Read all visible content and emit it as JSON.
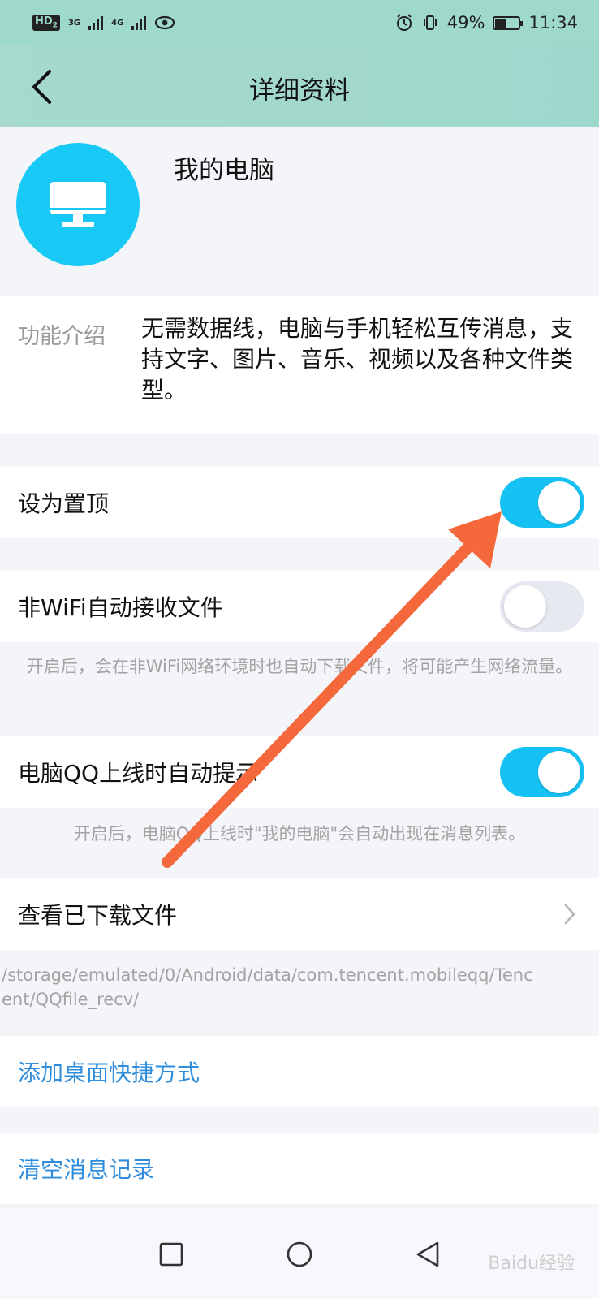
{
  "status_bar": {
    "hd": "HD",
    "hd_sub": "2",
    "net1": "3G",
    "net2": "4G",
    "battery": "49%",
    "time": "11:34"
  },
  "header": {
    "title": "详细资料"
  },
  "profile": {
    "name": "我的电脑"
  },
  "intro": {
    "label": "功能介绍",
    "text": "无需数据线，电脑与手机轻松互传消息，支持文字、图片、音乐、视频以及各种文件类型。"
  },
  "settings": {
    "pin": {
      "label": "设为置顶",
      "on": true
    },
    "nonwifi": {
      "label": "非WiFi自动接收文件",
      "on": false,
      "note": "开启后，会在非WiFi网络环境时也自动下载文件，将可能产生网络流量。"
    },
    "online_prompt": {
      "label": "电脑QQ上线时自动提示",
      "on": true,
      "note": "开启后，电脑QQ上线时\"我的电脑\"会自动出现在消息列表。"
    },
    "downloads": {
      "label": "查看已下载文件",
      "path": "/storage/emulated/0/Android/data/com.tencent.mobileqq/Tencent/QQfile_recv/"
    },
    "shortcut": {
      "label": "添加桌面快捷方式"
    },
    "clear": {
      "label": "清空消息记录"
    }
  },
  "watermark": "Baidu经验",
  "colors": {
    "accent": "#16c1f4",
    "header_bg": "#9fd9cc",
    "link": "#2f8ddb",
    "arrow": "#f4683c"
  }
}
